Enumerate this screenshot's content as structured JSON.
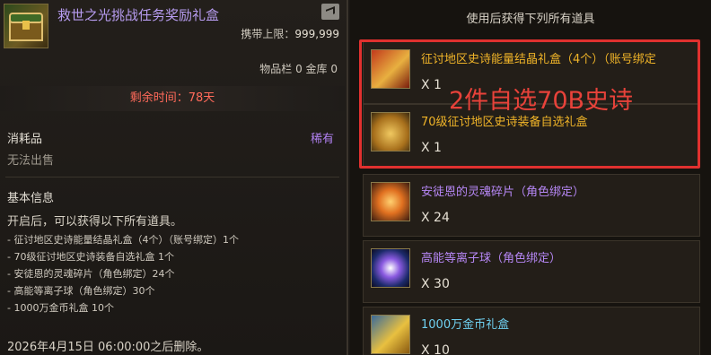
{
  "left": {
    "title": "救世之光挑战任务奖励礼盒",
    "carry_label": "携带上限：",
    "carry_value": "999,999",
    "inventory": "物品栏 0 金库 0",
    "remaining_time": "剩余时间：78天",
    "category": "消耗品",
    "rarity": "稀有",
    "tradability": "无法出售",
    "basic_info_header": "基本信息",
    "description": "开启后，可以获得以下所有道具。",
    "contents": [
      "- 征讨地区史诗能量结晶礼盒（4个）（账号绑定）1个",
      "- 70级征讨地区史诗装备自选礼盒 1个",
      "- 安徒恩的灵魂碎片（角色绑定）24个",
      "- 高能等离子球（角色绑定）30个",
      "- 1000万金币礼盒 10个"
    ],
    "expiry": "2026年4月15日 06:00:00之后删除。",
    "colors": {
      "title": "#b79cf0",
      "rarity": "#b080f0",
      "time": "#ff6a5a"
    }
  },
  "right": {
    "header": "使用后获得下列所有道具",
    "overlay_note": "2件自选70B史诗",
    "items": [
      {
        "name": "征讨地区史诗能量结晶礼盒（4个）（账号绑定",
        "qty": "X 1",
        "color": "#f0b428",
        "icon": "red-gold-giftbox-icon"
      },
      {
        "name": "70级征讨地区史诗装备自选礼盒",
        "qty": "X 1",
        "color": "#f0b428",
        "icon": "golden-pot-icon"
      },
      {
        "name": "安徒恩的灵魂碎片（角色绑定）",
        "qty": "X 24",
        "color": "#b687f5",
        "icon": "soul-shard-icon"
      },
      {
        "name": "高能等离子球（角色绑定）",
        "qty": "X 30",
        "color": "#b687f5",
        "icon": "plasma-orb-icon"
      },
      {
        "name": "1000万金币礼盒",
        "qty": "X 10",
        "color": "#6fd0f0",
        "icon": "gold-coin-chest-icon"
      }
    ]
  }
}
